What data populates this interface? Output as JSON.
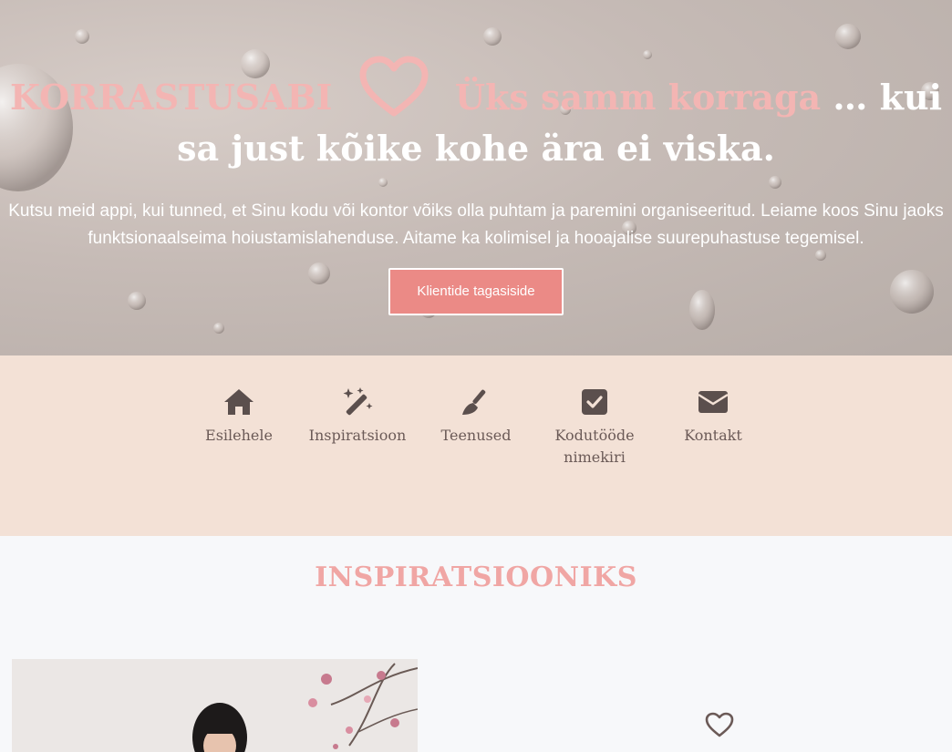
{
  "hero": {
    "brand": "KORRASTUSABI",
    "tagline_pink": "Üks samm korraga",
    "tagline_rest": "… kui sa just kõike kohe ära ei viska.",
    "description": "Kutsu meid appi, kui tunned, et Sinu kodu või kontor võiks olla puhtam ja paremini organiseeritud. Leiame koos Sinu jaoks funktsionaalseima hoiustamislahenduse. Aitame ka kolimisel ja hooajalise suurepuhastuse tegemisel.",
    "cta_label": "Klientide tagasiside",
    "heart_icon": "heart-outline-icon"
  },
  "nav": {
    "items": [
      {
        "label": "Esilehele",
        "icon": "home-icon"
      },
      {
        "label": "Inspiratsioon",
        "icon": "magic-wand-icon"
      },
      {
        "label": "Teenused",
        "icon": "broom-icon"
      },
      {
        "label": "Kodutööde nimekiri",
        "icon": "checkbox-icon"
      },
      {
        "label": "Kontakt",
        "icon": "envelope-icon"
      }
    ]
  },
  "inspiration": {
    "title": "INSPIRATSIOONIKS",
    "heart_icon": "heart-outline-icon"
  },
  "colors": {
    "accent_pink": "#f3b5b3",
    "button": "#eb8a86",
    "nav_bg": "#f3e1d6",
    "nav_text": "#6b5a57"
  }
}
